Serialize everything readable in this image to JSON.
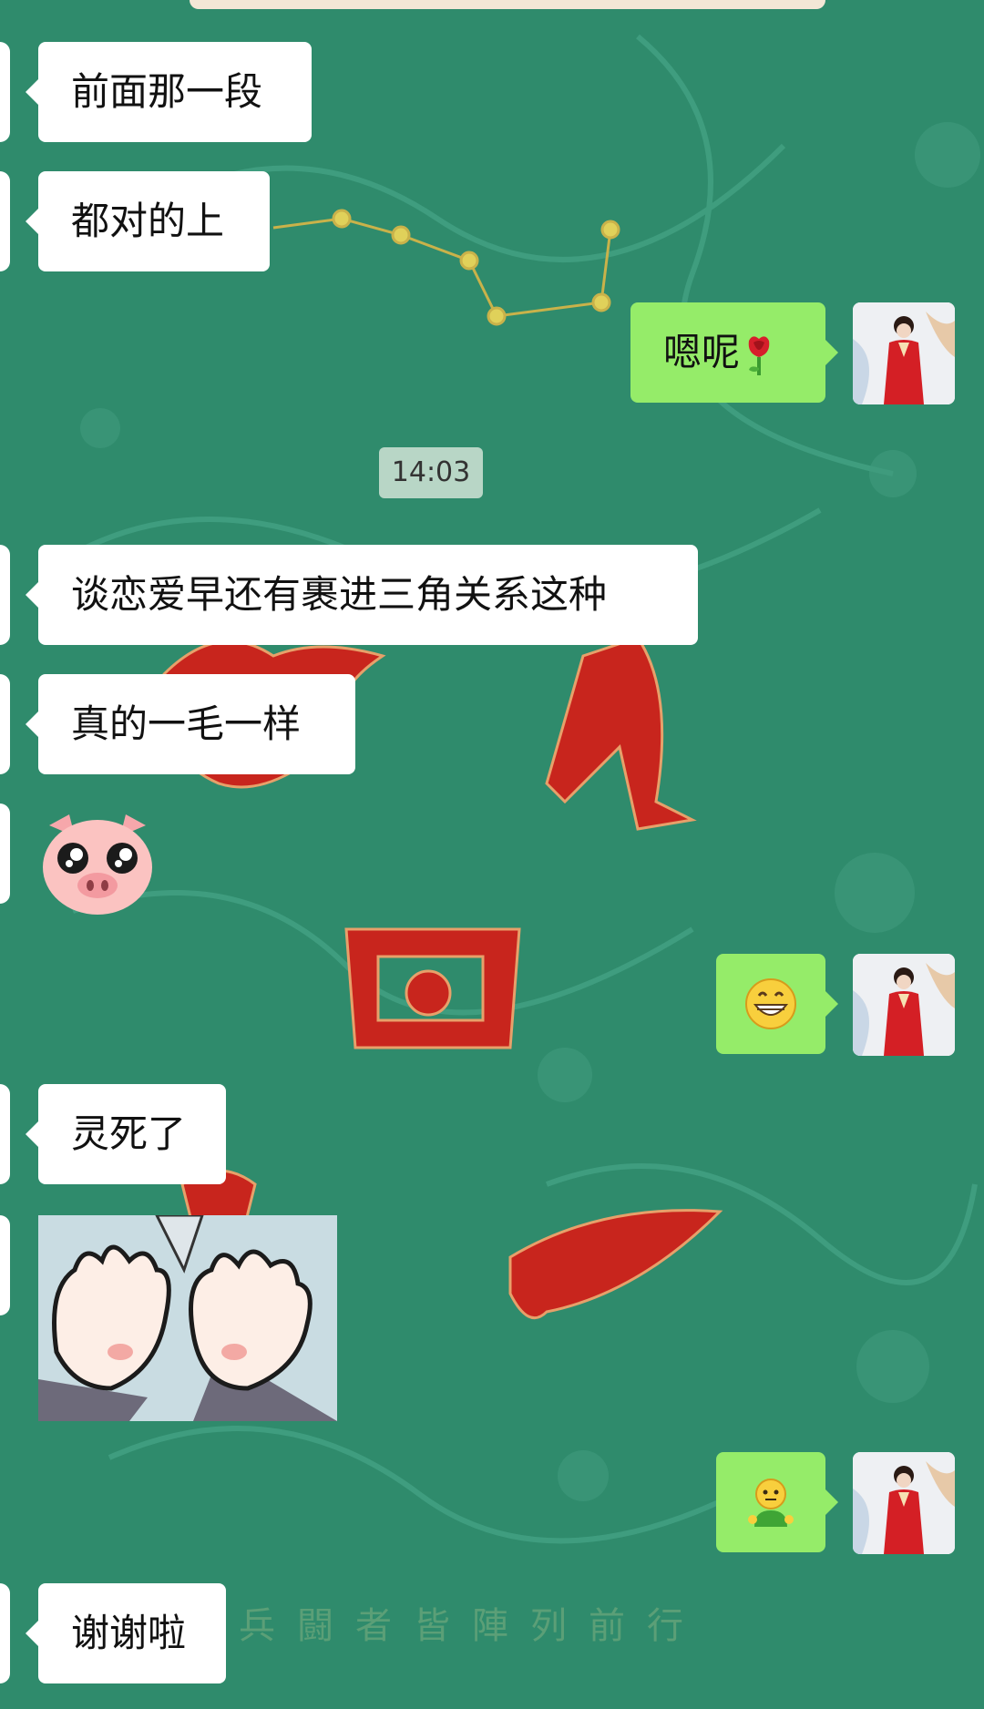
{
  "timestamp": "14:03",
  "watermark": "兵闘者皆陣列前行",
  "messages": [
    {
      "side": "left",
      "type": "text",
      "text": "前面那一段"
    },
    {
      "side": "left",
      "type": "text",
      "text": "都对的上"
    },
    {
      "side": "right",
      "type": "text",
      "text": "嗯呢"
    },
    {
      "side": "left",
      "type": "text",
      "text": "谈恋爱早还有裹进三角关系这种"
    },
    {
      "side": "left",
      "type": "text",
      "text": "真的一毛一样"
    },
    {
      "side": "left",
      "type": "sticker",
      "sticker": "pig-face-sticker"
    },
    {
      "side": "right",
      "type": "emoji",
      "emoji": "grinning-face-icon"
    },
    {
      "side": "left",
      "type": "text",
      "text": "灵死了"
    },
    {
      "side": "left",
      "type": "sticker",
      "sticker": "cartoon-hands-sticker"
    },
    {
      "side": "right",
      "type": "emoji",
      "emoji": "emoji-person-icon"
    },
    {
      "side": "left",
      "type": "text",
      "text": "谢谢啦"
    }
  ],
  "colors": {
    "background": "#2e8a6b",
    "left_bubble": "#ffffff",
    "right_bubble": "#95ec69",
    "timestamp_bg": "#b8d6c6",
    "accent_red": "#c8251d"
  }
}
